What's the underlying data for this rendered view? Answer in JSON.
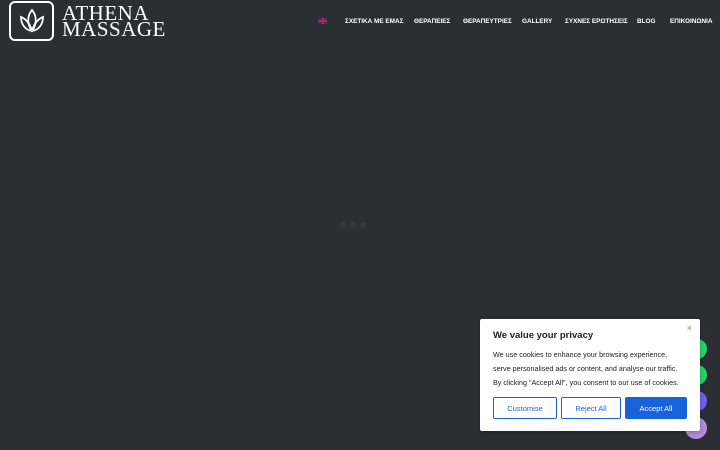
{
  "brand": {
    "line1": "ATHENA",
    "line2": "MASSAGE"
  },
  "nav": {
    "language_flag": "uk-flag-icon",
    "items": [
      "ΣΧΕΤΙΚΑ ΜΕ ΕΜΑΣ",
      "ΘΕΡΑΠΕΙΕΣ",
      "ΘΕΡΑΠΕΥΤΡΙΕΣ",
      "GALLERY",
      "ΣΥΧΝΕΣ ΕΡΩΤΗΣΕΙΣ",
      "BLOG",
      "ΕΠΙΚΟΙΝΩΝΙΑ"
    ]
  },
  "cookie": {
    "title": "We value your privacy",
    "text_line1": "We use cookies to enhance your browsing experience,",
    "text_line2": "serve personalised ads or content, and analyse our traffic.",
    "text_line3": "By clicking \"Accept All\", you consent to our use of cookies.",
    "close": "×",
    "customise": "Customise",
    "reject": "Reject All",
    "accept": "Accept All"
  },
  "floating_buttons": [
    "whatsapp-icon",
    "whatsapp-icon",
    "viber-icon",
    "chat-icon"
  ],
  "colors": {
    "background": "#2b2e32",
    "accent_blue": "#1863dc",
    "whatsapp_green": "#25d366",
    "viber_purple": "#7360f2",
    "chat_lilac": "#b18cdb"
  }
}
